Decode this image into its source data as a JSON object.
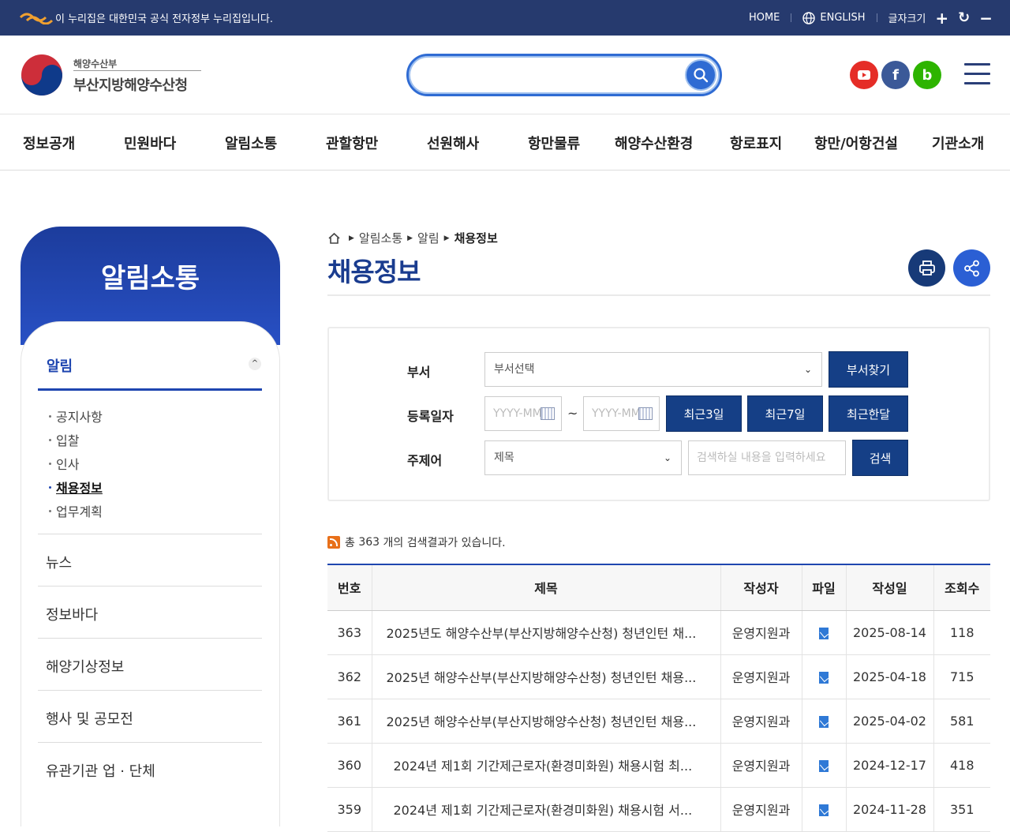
{
  "topbar": {
    "gov_notice": "이 누리집은 대한민국 공식 전자정부 누리집입니다.",
    "home": "HOME",
    "english": "ENGLISH",
    "font_size": "글자크기",
    "plus": "+",
    "reset": "↻",
    "minus": "−"
  },
  "header": {
    "org_small": "해양수산부",
    "org_main": "부산지방해양수산청",
    "search": {
      "placeholder": "",
      "value": ""
    },
    "sns": [
      {
        "name": "youtube",
        "glyph": "▶",
        "color": "#e52d27"
      },
      {
        "name": "facebook",
        "glyph": "f",
        "color": "#3b5998"
      },
      {
        "name": "blog",
        "glyph": "b",
        "color": "#2db400"
      }
    ]
  },
  "gnb": [
    "정보공개",
    "민원바다",
    "알림소통",
    "관할항만",
    "선원해사",
    "항만물류",
    "해양수산환경",
    "항로표지",
    "항만/어항건설",
    "기관소개"
  ],
  "sidebar": {
    "title": "알림소통",
    "current": "알림",
    "toggle": "^",
    "sub_items": [
      {
        "label": "공지사항",
        "active": false
      },
      {
        "label": "입찰",
        "active": false
      },
      {
        "label": "인사",
        "active": false
      },
      {
        "label": "채용정보",
        "active": true
      },
      {
        "label": "업무계획",
        "active": false
      }
    ],
    "menus": [
      "뉴스",
      "정보바다",
      "해양기상정보",
      "행사 및 공모전",
      "유관기관 업 · 단체"
    ]
  },
  "breadcrumb": [
    "알림소통",
    "알림",
    "채용정보"
  ],
  "page_title": "채용정보",
  "search_form": {
    "dept_label": "부서",
    "dept_value": "부서선택",
    "dept_button": "부서찾기",
    "date_label": "등록일자",
    "date_from_placeholder": "YYYY-MM-DD",
    "date_to_placeholder": "YYYY-MM-DD",
    "tilde": "~",
    "quick_3d": "최근3일",
    "quick_7d": "최근7일",
    "quick_1m": "최근한달",
    "topic_label": "주제어",
    "topic_value": "제목",
    "keyword_placeholder": "검색하실 내용을 입력하세요",
    "search_button": "검색"
  },
  "result": {
    "prefix": "총",
    "count": "363",
    "suffix": "개의 검색결과가 있습니다."
  },
  "table": {
    "headers": [
      "번호",
      "제목",
      "작성자",
      "파일",
      "작성일",
      "조회수"
    ],
    "rows": [
      {
        "no": "363",
        "title": "2025년도 해양수산부(부산지방해양수산청) 청년인턴 채...",
        "writer": "운영지원과",
        "date": "2025-08-14",
        "views": "118"
      },
      {
        "no": "362",
        "title": "2025년 해양수산부(부산지방해양수산청) 청년인턴 채용...",
        "writer": "운영지원과",
        "date": "2025-04-18",
        "views": "715"
      },
      {
        "no": "361",
        "title": "2025년 해양수산부(부산지방해양수산청) 청년인턴 채용...",
        "writer": "운영지원과",
        "date": "2025-04-02",
        "views": "581"
      },
      {
        "no": "360",
        "title": "2024년 제1회 기간제근로자(환경미화원) 채용시험 최...",
        "writer": "운영지원과",
        "date": "2024-12-17",
        "views": "418"
      },
      {
        "no": "359",
        "title": "2024년 제1회 기간제근로자(환경미화원) 채용시험 서...",
        "writer": "운영지원과",
        "date": "2024-11-28",
        "views": "351"
      }
    ]
  }
}
